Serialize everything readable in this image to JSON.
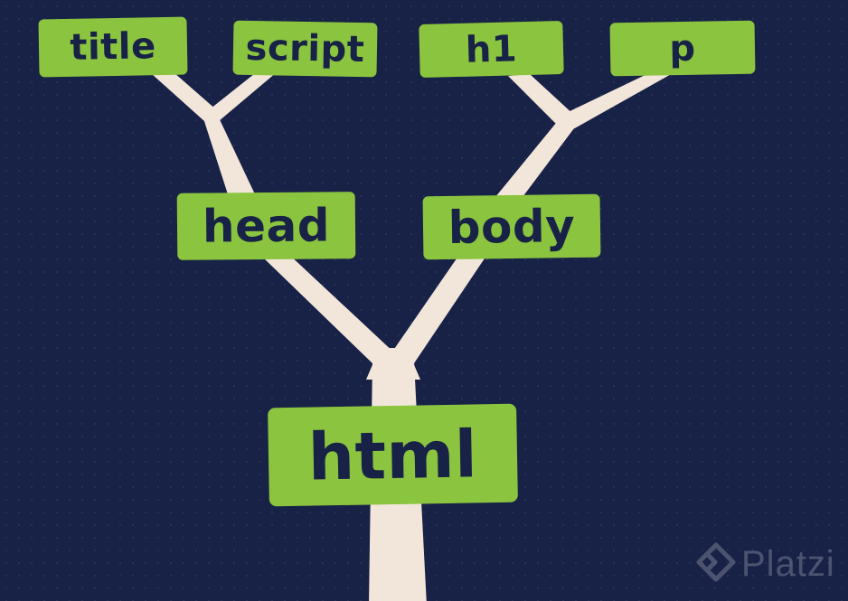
{
  "colors": {
    "background": "#182246",
    "node_fill": "#8bc43f",
    "node_text": "#182246",
    "branch": "#f2e6da"
  },
  "nodes": {
    "title": "title",
    "script": "script",
    "h1": "h1",
    "p": "p",
    "head": "head",
    "body": "body",
    "html": "html"
  },
  "watermark": {
    "text": "Platzi",
    "icon": "platzi-logo-icon"
  }
}
